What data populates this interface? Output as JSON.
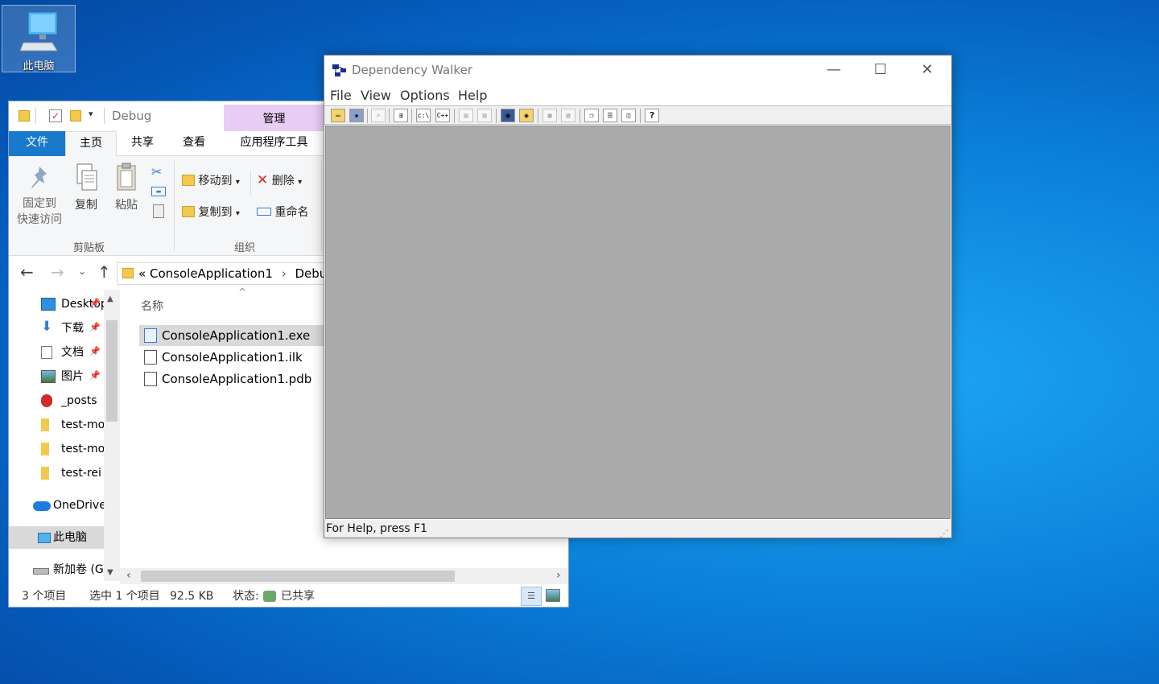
{
  "desktop": {
    "icon_label": "此电脑"
  },
  "explorer": {
    "title": "Debug",
    "context_tab": "管理",
    "tabs": [
      "文件",
      "主页",
      "共享",
      "查看",
      "应用程序工具"
    ],
    "ribbon": {
      "pin_label_1": "固定到",
      "pin_label_2": "快速访问",
      "copy_label": "复制",
      "paste_label": "粘贴",
      "clipboard_group": "剪贴板",
      "move_to": "移动到",
      "copy_to": "复制到",
      "delete": "删除",
      "rename": "重命名",
      "organize_group": "组织"
    },
    "address": {
      "chevrons": "«",
      "segment1": "ConsoleApplication1",
      "separator": "›",
      "segment2": "Debug"
    },
    "nav_items": [
      {
        "label": "Desktop",
        "pinned": true
      },
      {
        "label": "下载",
        "pinned": true
      },
      {
        "label": "文档",
        "pinned": true
      },
      {
        "label": "图片",
        "pinned": true
      },
      {
        "label": "_posts",
        "pinned": false
      },
      {
        "label": "test-mo",
        "pinned": false
      },
      {
        "label": "test-mo",
        "pinned": false
      },
      {
        "label": "test-rei",
        "pinned": false
      },
      {
        "label": "OneDrive",
        "pinned": false
      },
      {
        "label": "此电脑",
        "pinned": false
      },
      {
        "label": "新加卷 (G",
        "pinned": false
      }
    ],
    "column_header": "名称",
    "files": [
      {
        "name": "ConsoleApplication1.exe",
        "selected": true
      },
      {
        "name": "ConsoleApplication1.ilk",
        "selected": false
      },
      {
        "name": "ConsoleApplication1.pdb",
        "selected": false
      }
    ],
    "status": {
      "count": "3 个项目",
      "selection": "选中 1 个项目",
      "size": "92.5 KB",
      "state_label": "状态:",
      "state_value": "已共享"
    }
  },
  "depwalker": {
    "title": "Dependency Walker",
    "menu": [
      "File",
      "View",
      "Options",
      "Help"
    ],
    "toolbar_texts": {
      "cpath": "c:\\",
      "cpp": "C++",
      "help": "?"
    },
    "status_text": "For Help, press F1"
  },
  "colors": {
    "accent_file_tab": "#1979ca",
    "manage_tab": "#e8cdf5",
    "dw_client": "#ababab",
    "desktop_blue": "#0a7fd8"
  }
}
